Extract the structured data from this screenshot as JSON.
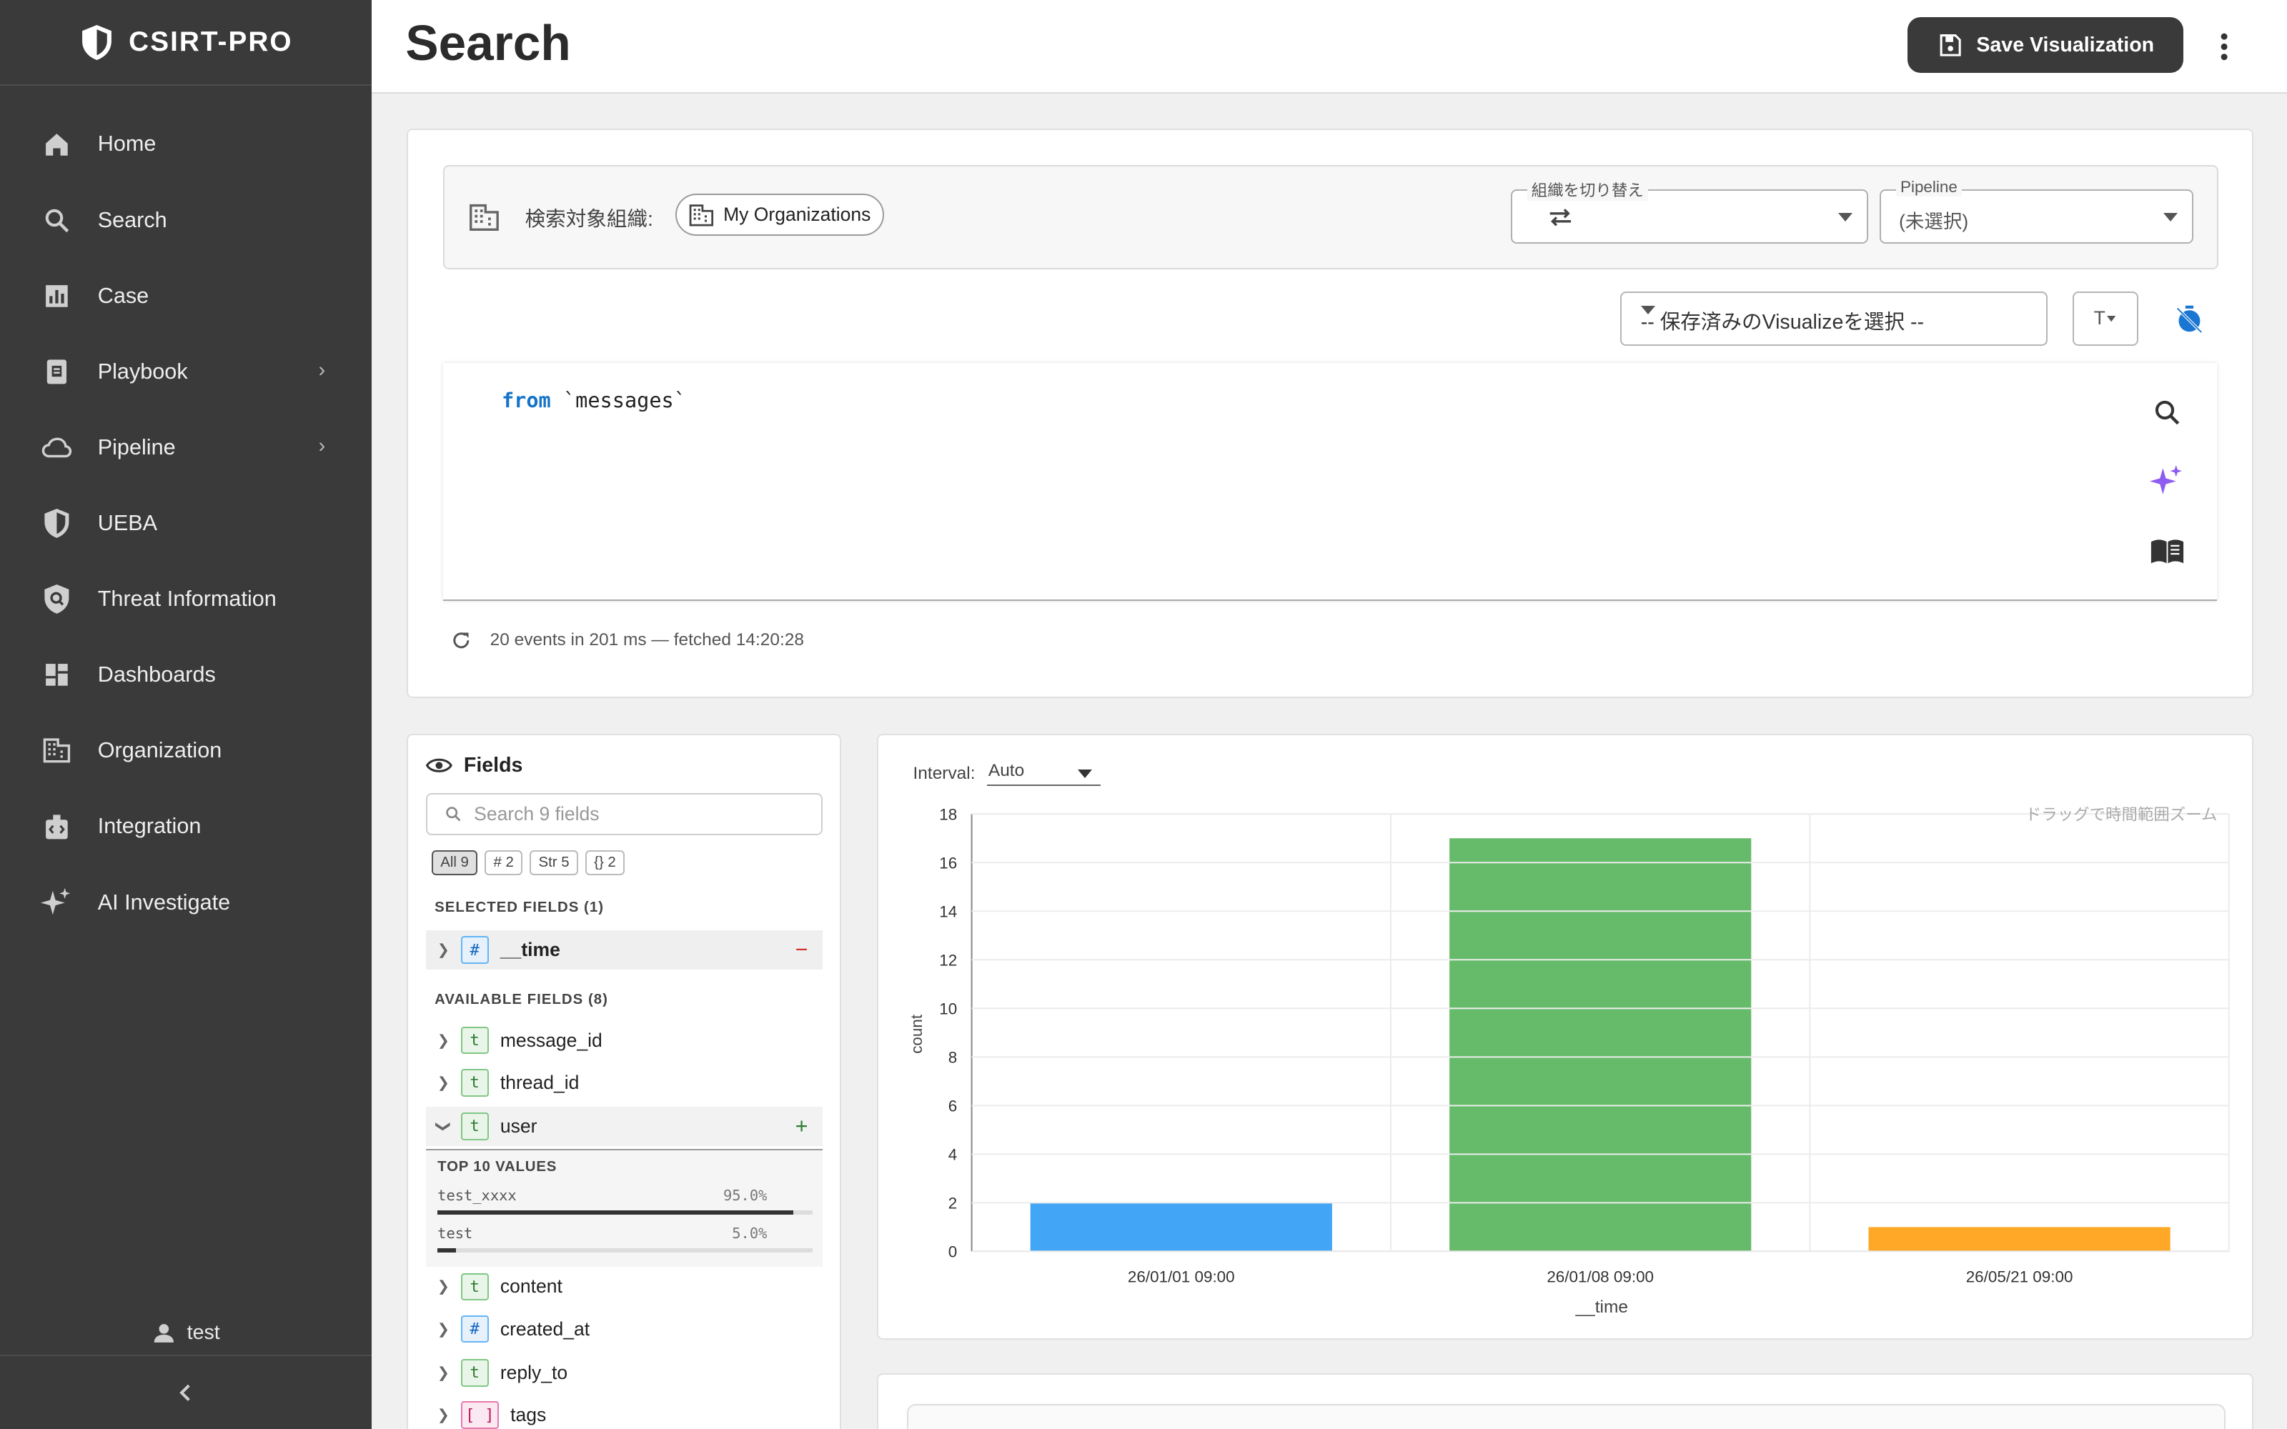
{
  "app": {
    "brand": "CSIRT-PRO"
  },
  "sidebar": {
    "items": [
      {
        "label": "Home",
        "icon": "home-icon"
      },
      {
        "label": "Search",
        "icon": "search-icon"
      },
      {
        "label": "Case",
        "icon": "bar-chart-icon"
      },
      {
        "label": "Playbook",
        "icon": "book-icon",
        "expandable": true
      },
      {
        "label": "Pipeline",
        "icon": "cloud-icon",
        "expandable": true
      },
      {
        "label": "UEBA",
        "icon": "shield-icon"
      },
      {
        "label": "Threat Information",
        "icon": "shield-search-icon"
      },
      {
        "label": "Dashboards",
        "icon": "dashboard-icon"
      },
      {
        "label": "Organization",
        "icon": "building-icon"
      },
      {
        "label": "Integration",
        "icon": "integration-icon"
      },
      {
        "label": "AI Investigate",
        "icon": "sparkle-icon"
      }
    ],
    "user": "test"
  },
  "header": {
    "title": "Search",
    "save_label": "Save Visualization"
  },
  "query": {
    "org_label": "検索対象組織:",
    "org_chip": "My Organizations",
    "switch_org_legend": "組織を切り替え",
    "pipeline_legend": "Pipeline",
    "pipeline_value": "(未選択)",
    "saved_viz_placeholder": "-- 保存済みのVisualizeを選択 --",
    "tz_label": "T",
    "code_keyword": "from",
    "code_rest": " `messages`",
    "status": "20 events in 201 ms — fetched 14:20:28"
  },
  "fields_panel": {
    "title": "Fields",
    "search_placeholder": "Search 9 fields",
    "filters": [
      "All 9",
      "# 2",
      "Str 5",
      "{} 2"
    ],
    "selected_header": "SELECTED FIELDS (1)",
    "selected": [
      {
        "name": "__time",
        "type": "#"
      }
    ],
    "available_header": "AVAILABLE FIELDS (8)",
    "available": [
      {
        "name": "message_id",
        "type": "t"
      },
      {
        "name": "thread_id",
        "type": "t"
      },
      {
        "name": "user",
        "type": "t"
      },
      {
        "name": "content",
        "type": "t"
      },
      {
        "name": "created_at",
        "type": "#"
      },
      {
        "name": "reply_to",
        "type": "t"
      },
      {
        "name": "tags",
        "type": "[ ]"
      }
    ],
    "top_values": {
      "title": "TOP 10 VALUES",
      "rows": [
        {
          "value": "test_xxxx",
          "pct": "95.0%",
          "frac": 0.95
        },
        {
          "value": "test",
          "pct": "5.0%",
          "frac": 0.05
        }
      ]
    }
  },
  "chart": {
    "interval_label": "Interval:",
    "interval_value": "Auto",
    "zoom_hint": "ドラッグで時間範囲ズーム"
  },
  "chart_data": {
    "type": "bar",
    "categories": [
      "26/01/01 09:00",
      "26/01/08 09:00",
      "26/05/21 09:00"
    ],
    "values": [
      2,
      17,
      1
    ],
    "colors": [
      "#42a5f5",
      "#66bb6a",
      "#ffa726"
    ],
    "xlabel": "__time",
    "ylabel": "count",
    "ylim": [
      0,
      18
    ],
    "yticks": [
      0,
      2,
      4,
      6,
      8,
      10,
      12,
      14,
      16,
      18
    ],
    "grid": true
  }
}
